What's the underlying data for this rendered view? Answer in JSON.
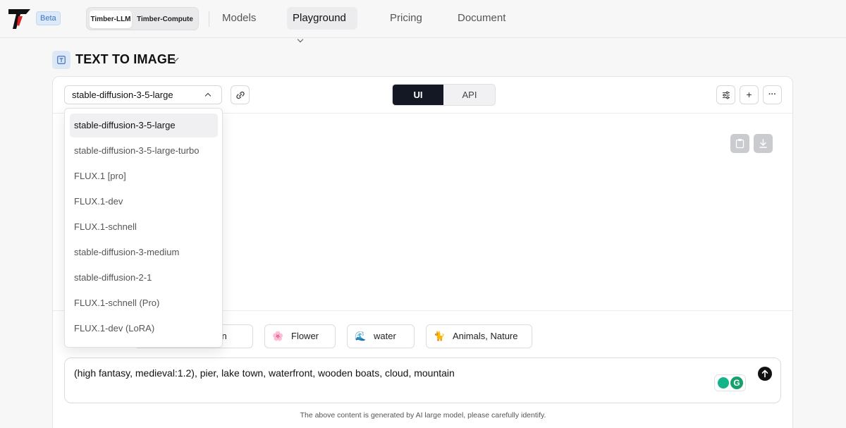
{
  "header": {
    "beta_label": "Beta",
    "products": [
      {
        "label": "Timber-LLM",
        "active": true
      },
      {
        "label": "Timber-Compute",
        "active": false
      }
    ],
    "nav": [
      {
        "label": "Models",
        "active": false
      },
      {
        "label": "Playground",
        "active": true,
        "has_dropdown": true
      },
      {
        "label": "Pricing",
        "active": false
      },
      {
        "label": "Document",
        "active": false
      }
    ]
  },
  "section": {
    "title": "TEXT TO IMAGE"
  },
  "toolbar": {
    "model_selected": "stable-diffusion-3-5-large",
    "mode_options": [
      "UI",
      "API"
    ],
    "mode_active": "UI",
    "add_label": "+",
    "more_label": "···"
  },
  "model_dropdown": {
    "options": [
      "stable-diffusion-3-5-large",
      "stable-diffusion-3-5-large-turbo",
      "FLUX.1 [pro]",
      "FLUX.1-dev",
      "FLUX.1-schnell",
      "stable-diffusion-3-medium",
      "stable-diffusion-2-1",
      "FLUX.1-schnell (Pro)",
      "FLUX.1-dev (LoRA)"
    ],
    "selected_index": 0
  },
  "chips": [
    {
      "label": "nan",
      "icon": "person-icon"
    },
    {
      "label": "Flower",
      "icon": "flower-icon",
      "emoji": "🌸"
    },
    {
      "label": "water",
      "icon": "wave-icon",
      "emoji": "🌊"
    },
    {
      "label": "Animals, Nature",
      "icon": "animal-icon",
      "emoji": "🐈"
    }
  ],
  "prompt": {
    "value": "(high fantasy, medieval:1.2), pier,  lake town, waterfront, wooden boats, cloud, mountain",
    "grammarly_letter": "G"
  },
  "disclaimer": "The above content is generated by AI large model, please carefully identify.",
  "colors": {
    "accent_dark": "#141824",
    "logo_red": "#e02020",
    "beta_bg": "#dde9f8"
  }
}
